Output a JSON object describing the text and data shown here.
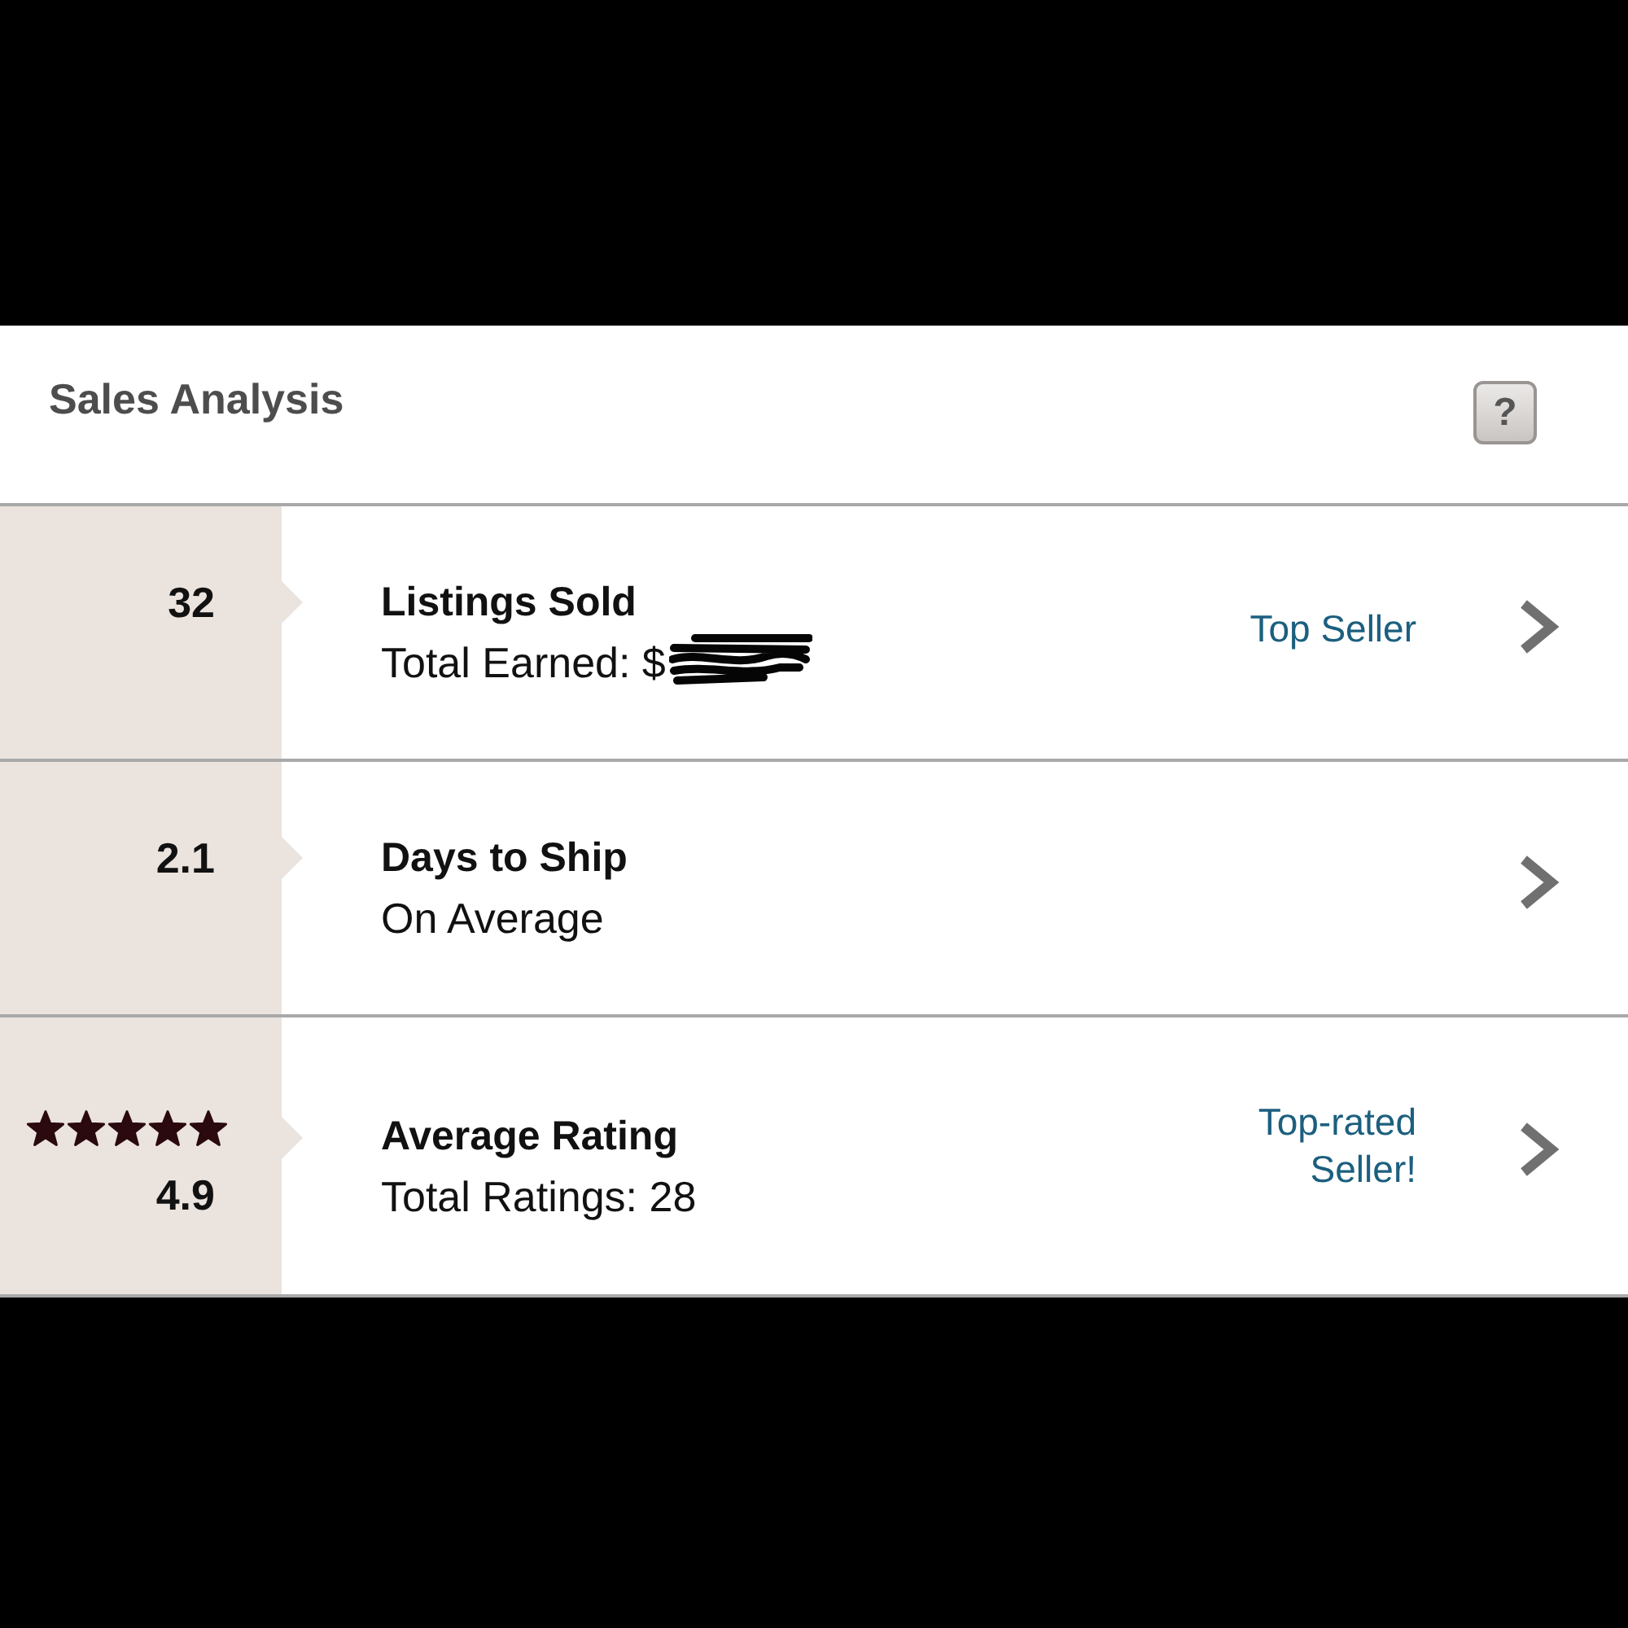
{
  "header": {
    "title": "Sales Analysis",
    "help_button": "?"
  },
  "metrics": [
    {
      "value": "32",
      "title": "Listings Sold",
      "subtitle": "Total Earned: $",
      "redacted": true,
      "badge": "Top Seller"
    },
    {
      "value": "2.1",
      "title": "Days to Ship",
      "subtitle": "On Average",
      "redacted": false
    },
    {
      "value": "4.9",
      "stars": 5,
      "title": "Average Rating",
      "subtitle": "Total Ratings: 28",
      "redacted": false,
      "badge": "Top-rated Seller!"
    }
  ]
}
